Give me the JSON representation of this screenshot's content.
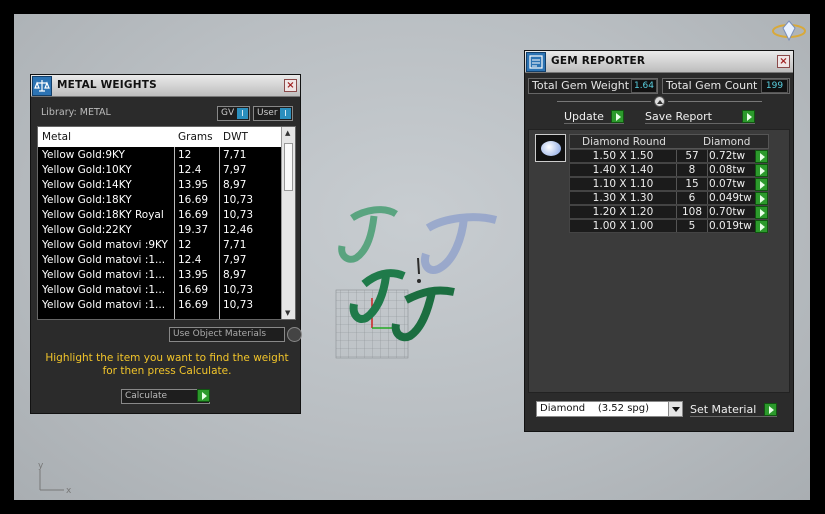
{
  "metal_panel": {
    "title": "METAL WEIGHTS",
    "library_label": "Library: METAL",
    "toggles": [
      {
        "label": "GV",
        "value": "I"
      },
      {
        "label": "User",
        "value": "I"
      }
    ],
    "columns": [
      "Metal",
      "Grams",
      "DWT"
    ],
    "rows": [
      [
        "Yellow Gold:9KY",
        "12",
        "7,71"
      ],
      [
        "Yellow Gold:10KY",
        "12.4",
        "7,97"
      ],
      [
        "Yellow Gold:14KY",
        "13.95",
        "8,97"
      ],
      [
        "Yellow Gold:18KY",
        "16.69",
        "10,73"
      ],
      [
        "Yellow Gold:18KY Royal",
        "16.69",
        "10,73"
      ],
      [
        "Yellow Gold:22KY",
        "19.37",
        "12,46"
      ],
      [
        "Yellow Gold matovi :9KY",
        "12",
        "7,71"
      ],
      [
        "Yellow Gold matovi :1...",
        "12.4",
        "7,97"
      ],
      [
        "Yellow Gold matovi :1...",
        "13.95",
        "8,97"
      ],
      [
        "Yellow Gold matovi :1...",
        "16.69",
        "10,73"
      ],
      [
        "Yellow Gold matovi :1...",
        "16.69",
        "10,73"
      ]
    ],
    "use_object_materials": "Use Object Materials",
    "hint": "Highlight the item you want to find the weight for then press Calculate.",
    "calculate": "Calculate"
  },
  "gem_panel": {
    "title": "GEM REPORTER",
    "total_weight_label": "Total Gem Weight",
    "total_weight_value": "1.64",
    "total_count_label": "Total Gem Count",
    "total_count_value": "199",
    "update": "Update",
    "save_report": "Save Report",
    "columns": [
      "Diamond Round",
      "Diamond"
    ],
    "rows": [
      [
        "1.50 X 1.50",
        "57",
        "0.72tw"
      ],
      [
        "1.40 X 1.40",
        "8",
        "0.08tw"
      ],
      [
        "1.10 X 1.10",
        "15",
        "0.07tw"
      ],
      [
        "1.30 X 1.30",
        "6",
        "0.049tw"
      ],
      [
        "1.20 X 1.20",
        "108",
        "0.70tw"
      ],
      [
        "1.00 X 1.00",
        "5",
        "0.019tw"
      ]
    ],
    "material_select": "Diamond    (3.52 spg)",
    "set_material": "Set Material"
  },
  "viewport": {
    "axis_y": "y",
    "axis_x": "x"
  }
}
